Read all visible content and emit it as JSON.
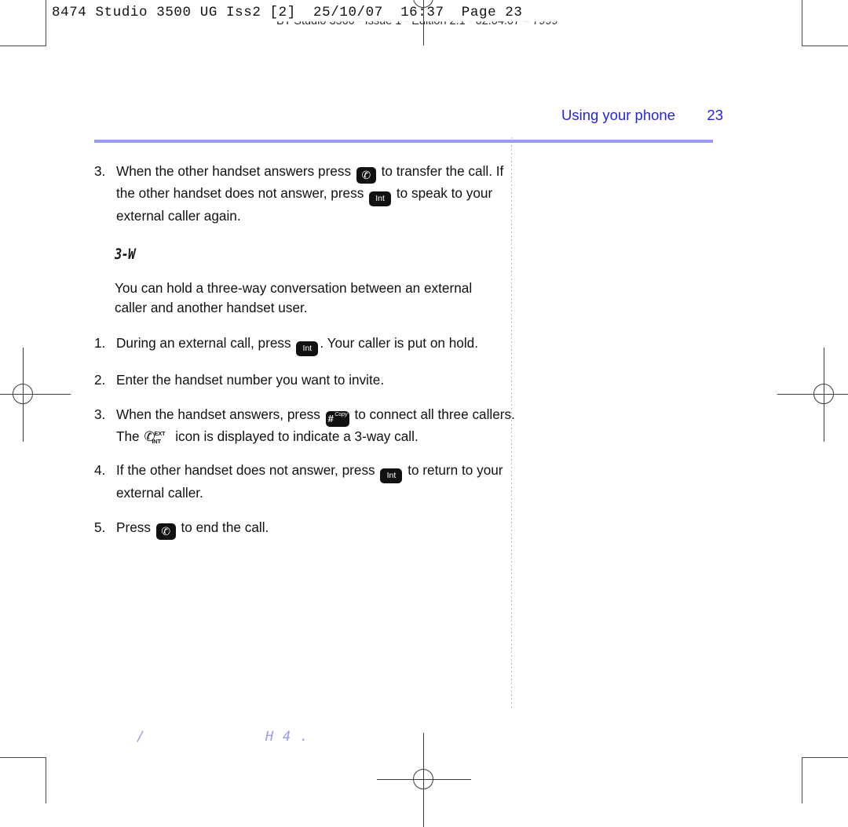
{
  "print_marks": {
    "header_line": "8474 Studio 3500 UG Iss2 [2]  25/10/07  16:37  Page 23",
    "doc_line": "BT Studio 3500 - Issue 1 - Edition 2.1 - 02.04.07 – 7999"
  },
  "header": {
    "section_title": "Using your phone",
    "page_number": "23",
    "rule_color": "#9a9af2",
    "text_color": "#2323e8"
  },
  "content": {
    "step3_top": {
      "number": "3.",
      "part1": "When the other handset answers press",
      "icon1": "phone-handset-key",
      "part2": "to transfer the call. If the other handset does not answer, press",
      "icon2": "int-key",
      "part3": "to speak to your external caller again."
    },
    "section_heading": "3-W",
    "intro": "You can hold a three-way conversation between an external caller and another handset user.",
    "steps": [
      {
        "number": "1.",
        "part1": "During an external call, press",
        "icon1": "int-key",
        "part2": ". Your caller is put on hold.",
        "part3": ""
      },
      {
        "number": "2.",
        "part1": "Enter the handset number you want to invite.",
        "icon1": "",
        "part2": "",
        "part3": ""
      },
      {
        "number": "3.",
        "part1": "When the handset answers, press",
        "icon1": "hash-copy-key",
        "part2": "to connect all three callers. The",
        "icon2": "ext-int-display-icon",
        "part3": "icon is displayed to indicate a 3-way call."
      },
      {
        "number": "4.",
        "part1": "If the other handset does not answer, press",
        "icon1": "int-key",
        "part2": "to return to your external caller.",
        "part3": ""
      },
      {
        "number": "5.",
        "part1": "Press",
        "icon1": "phone-handset-key",
        "part2": "to end the call.",
        "part3": ""
      }
    ]
  },
  "icon_labels": {
    "int_key": "Int",
    "phone_key": "☎",
    "hash_key": "#",
    "hash_key_sup": "Copy",
    "ext_label": "EXT",
    "int_label": "INT",
    "handset_glyph": "✆"
  },
  "lcd_artifacts": {
    "a1": "/",
    "a2": "H",
    "a3": "4",
    "a4": "."
  }
}
